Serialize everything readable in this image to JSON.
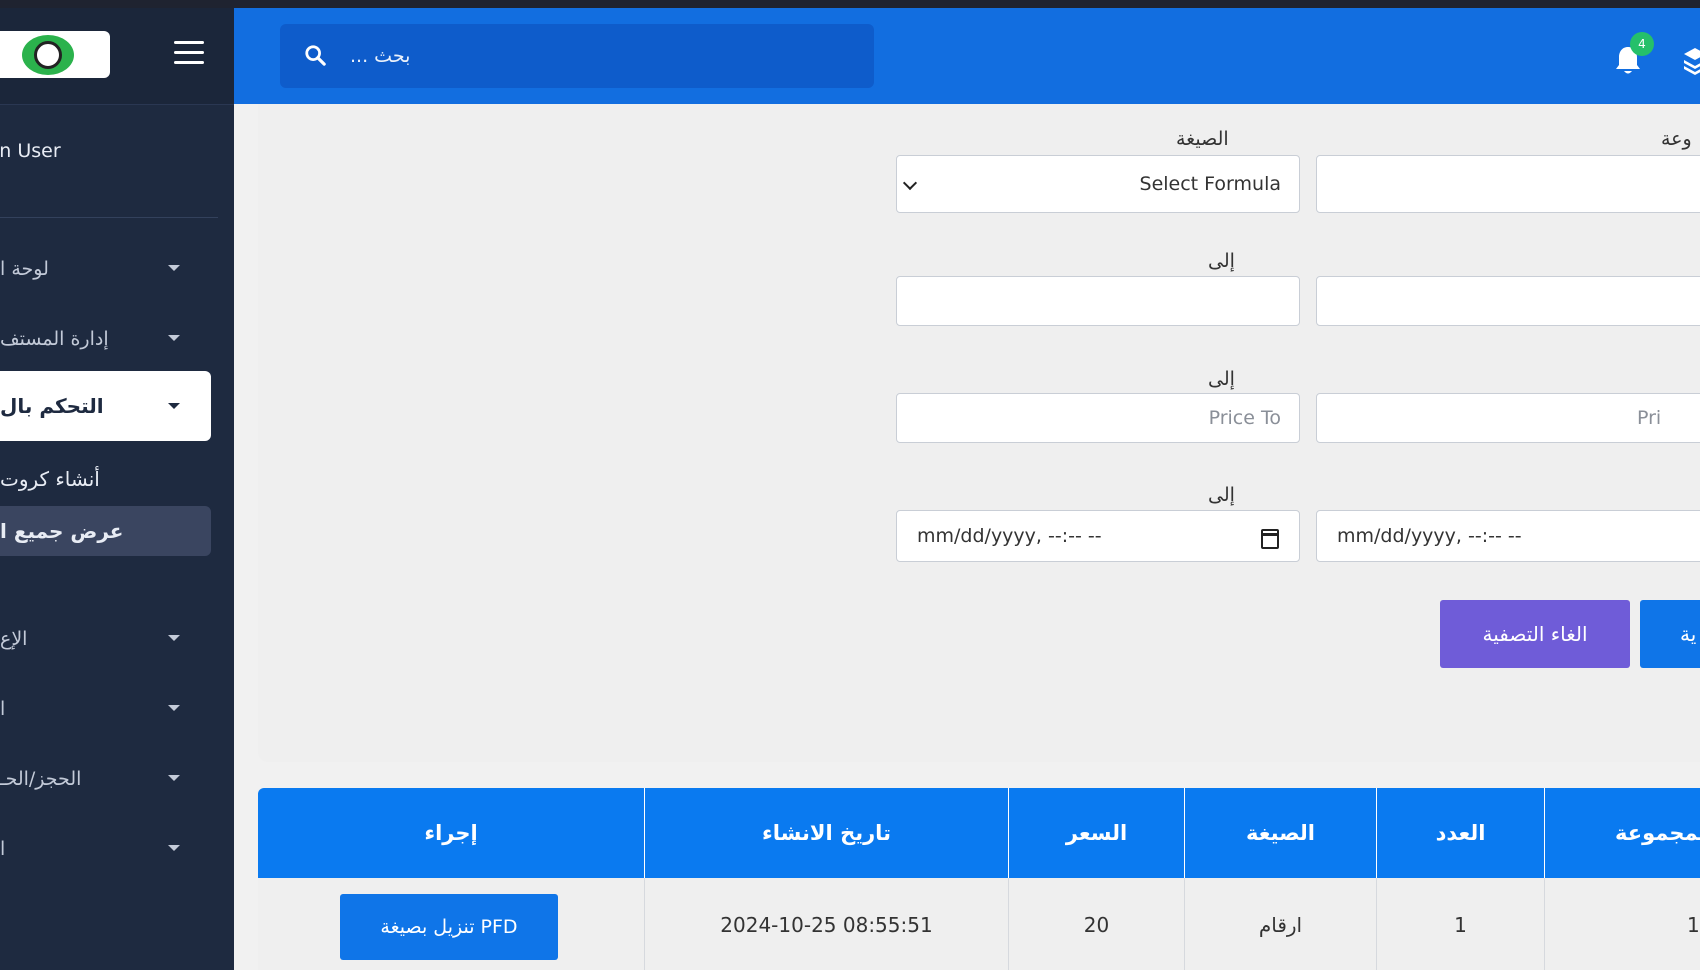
{
  "sidebar": {
    "user_name": "in User",
    "items": [
      {
        "label": "لوحة ا"
      },
      {
        "label": "إدارة المستف"
      },
      {
        "label": "التحكم بال"
      },
      {
        "label": "الإع"
      },
      {
        "label": "ا"
      },
      {
        "label": "الحجز/الحـ"
      },
      {
        "label": "ا"
      }
    ],
    "subitems": [
      {
        "label": "أنشاء كروت"
      },
      {
        "label": "عرض جميع ا"
      }
    ]
  },
  "header": {
    "search_placeholder": "بحث ...",
    "notifications_count": "4"
  },
  "filters": {
    "formula_label": "الصيغة",
    "formula_value": "Select Formula",
    "group_label": "وعة",
    "group_value": "",
    "count_to_label": "إلى",
    "price_to_label": "إلى",
    "price_to_placeholder": "Price To",
    "price_from_placeholder": "Pri",
    "date_to_label": "إلى",
    "date_to_value": "mm/dd/yyyy, --:-- --",
    "date_from_value": "mm/dd/yyyy, --:-- --",
    "reset_button": "الغاء التصفية",
    "apply_button": "ية"
  },
  "table": {
    "headers": [
      "إجراء",
      "تاريخ الانشاء",
      "السعر",
      "الصيغة",
      "العدد",
      "لمجموعة"
    ],
    "rows": [
      {
        "action": "تنزيل بصيغة PFD",
        "created": "2024-10-25 08:55:51",
        "price": "20",
        "formula": "ارقام",
        "count": "1",
        "group": "1"
      }
    ]
  },
  "colors": {
    "header_blue": "#126ee0",
    "sidebar_bg": "#1e2a40",
    "table_header": "#0a7af0",
    "reset_purple": "#6f5cd8",
    "badge_green": "#25c06a"
  }
}
